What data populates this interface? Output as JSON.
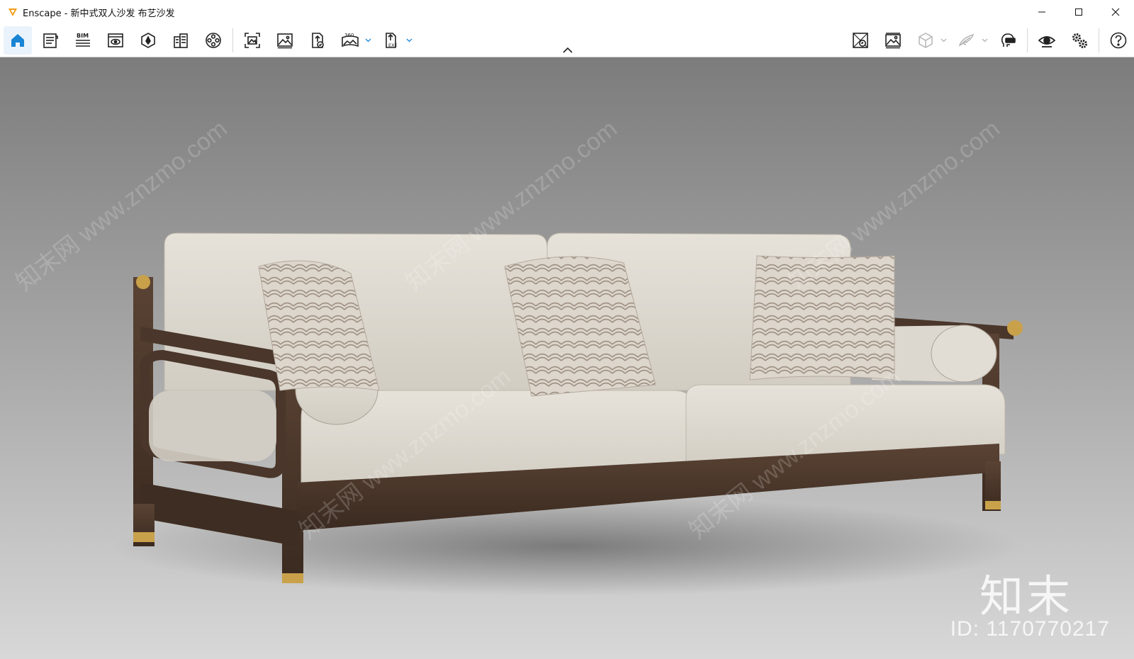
{
  "window": {
    "app_name": "Enscape",
    "title": "Enscape - 新中式双人沙发 布艺沙发",
    "controls": [
      "minimize-icon",
      "maximize-icon",
      "close-icon"
    ]
  },
  "toolbar": {
    "left_buttons": [
      {
        "name": "home-icon",
        "active": true
      },
      {
        "name": "asset-library-icon"
      },
      {
        "name": "bim-info-icon",
        "text": "BIM"
      },
      {
        "name": "views-icon"
      },
      {
        "name": "visual-settings-icon"
      },
      {
        "name": "material-editor-icon"
      },
      {
        "name": "video-editor-icon"
      },
      {
        "name": "screenshot-icon"
      },
      {
        "name": "batch-render-icon"
      },
      {
        "name": "upload-icon"
      },
      {
        "name": "panorama-icon",
        "text": "360",
        "dropdown": true
      },
      {
        "name": "export-icon",
        "text": "EXE",
        "dropdown": true
      }
    ],
    "right_buttons": [
      {
        "name": "live-update-icon"
      },
      {
        "name": "capture-view-icon"
      },
      {
        "name": "orthographic-cube-icon",
        "dropdown": true,
        "disabled": true
      },
      {
        "name": "flight-mode-icon",
        "dropdown": true,
        "disabled": true
      },
      {
        "name": "vr-headset-icon"
      },
      {
        "name": "preview-eye-icon"
      },
      {
        "name": "settings-gears-icon"
      },
      {
        "name": "help-icon"
      }
    ],
    "accent_color": "#1a84d4"
  },
  "viewport": {
    "watermark_brand": "知末",
    "watermark_id": "ID: 1170770217",
    "watermark_site": "知末网 www.znzmo.com",
    "background_color": "#8a8a8a"
  }
}
